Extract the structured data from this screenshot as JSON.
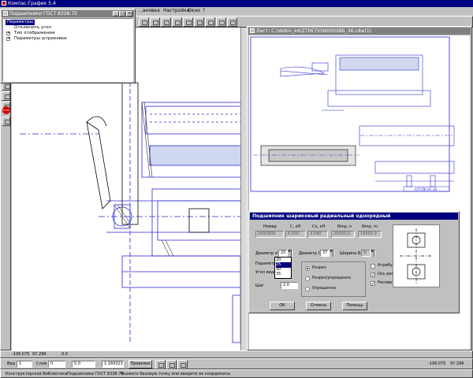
{
  "app": {
    "title": "Компас-График 5.4"
  },
  "menu": {
    "visible_items": [
      "...ановка",
      "Настройка",
      "Окно",
      "?"
    ]
  },
  "tree_window": {
    "title": "Подшипники ГОСТ 8338-75",
    "items": [
      "Параметры",
      "Отключить угол",
      "Тип отображения",
      "Параметры штриховки"
    ]
  },
  "drawing_window": {
    "title": "Лист: C:\\Velkin_k6\\ZTRETVSN0000ВБ_36.cdw(1)",
    "stamp_text": "АТПТВГОС 36"
  },
  "dialog": {
    "title": "Подшипник шариковый радиальный однорядный",
    "headers": {
      "nomer": "Номер",
      "c_kn": "С, кН",
      "co_kn": "Со, кН",
      "nmp_n": "Nmp, n",
      "nmp_m": "Nmp, m"
    },
    "values": {
      "nomer": "1000904",
      "c_kn": "6.550",
      "co_kn": "3.040",
      "nmp_n": "20000.0",
      "nmp_m": "16000.0"
    },
    "labels": {
      "diam_d": "Диаметр d",
      "diam_D": "Диаметр D",
      "width_B": "Ширина B",
      "params": "Параметры",
      "angle": "Угол вида",
      "step": "Шаг"
    },
    "inputs": {
      "diam_d": "20",
      "diam_D": "37",
      "width_B": "9",
      "angle": "45",
      "step": "2.0"
    },
    "dropdown_options": [
      "20",
      "25",
      "30",
      "35"
    ],
    "radios": [
      "Разрез",
      "Разрез/упрощенно",
      "Упрощенно"
    ],
    "checkboxes": [
      "Атрибуты",
      "Ось рисовать",
      "Рисовать справа"
    ],
    "buttons": {
      "ok": "ОК",
      "cancel": "Отмена",
      "help": "Помощь"
    }
  },
  "coords": {
    "x": "-106.075",
    "y": "97.296"
  },
  "props_bar": {
    "coord_readout": "0.0",
    "grid_label": "Вид",
    "grid_value": "1",
    "step_label": "Слой",
    "step_value": "0",
    "angle_value": "5.0",
    "scale_value": "1.169323",
    "mode_button": "Привязки",
    "right_x": "-106.075",
    "right_y": "97.296"
  },
  "status": {
    "library": "Конструкторская библиотека",
    "object": "Подшипники ГОСТ 8338-75",
    "hint": "Укажите базовую точку или введите ее координаты"
  },
  "colors": {
    "title_active": "#000080",
    "title_inactive": "#808080",
    "drawing_lines": "#2a2ad4",
    "canvas": "#ffffff"
  }
}
